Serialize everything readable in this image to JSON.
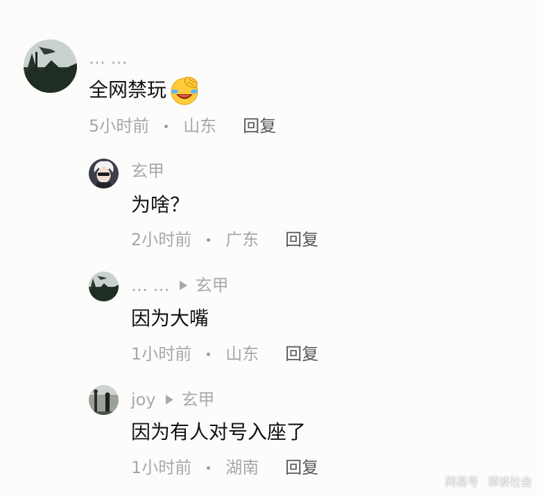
{
  "comments": [
    {
      "author": "… …",
      "text": "全网禁玩",
      "emoji": "face-palm-laugh-emoji",
      "time": "5小时前",
      "location": "山东",
      "reply_label": "回复",
      "avatar": "landscape-avatar"
    },
    {
      "author": "玄甲",
      "text": "为啥？",
      "time": "2小时前",
      "location": "广东",
      "reply_label": "回复",
      "avatar": "anime-white-hair-avatar"
    },
    {
      "author": "… …",
      "reply_to": "玄甲",
      "text": "因为大嘴",
      "time": "1小时前",
      "location": "山东",
      "reply_label": "回复",
      "avatar": "landscape-avatar"
    },
    {
      "author": "joy",
      "reply_to": "玄甲",
      "text": "因为有人对号入座了",
      "time": "1小时前",
      "location": "湖南",
      "reply_label": "回复",
      "avatar": "silhouette-avatar"
    }
  ],
  "watermark": {
    "brand": "网易号",
    "account": "谭谈社会"
  }
}
